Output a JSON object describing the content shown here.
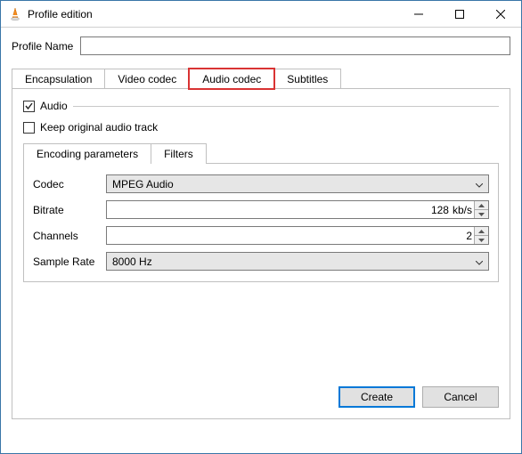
{
  "window": {
    "title": "Profile edition"
  },
  "profile": {
    "name_label": "Profile Name",
    "name_value": ""
  },
  "tabs": {
    "encapsulation": "Encapsulation",
    "video": "Video codec",
    "audio": "Audio codec",
    "subtitles": "Subtitles"
  },
  "audio_panel": {
    "section_label": "Audio",
    "keep_original_label": "Keep original audio track",
    "subtabs": {
      "encoding": "Encoding parameters",
      "filters": "Filters"
    },
    "fields": {
      "codec_label": "Codec",
      "codec_value": "MPEG Audio",
      "bitrate_label": "Bitrate",
      "bitrate_value": "128",
      "bitrate_unit": "kb/s",
      "channels_label": "Channels",
      "channels_value": "2",
      "samplerate_label": "Sample Rate",
      "samplerate_value": "8000 Hz"
    }
  },
  "buttons": {
    "create": "Create",
    "cancel": "Cancel"
  }
}
